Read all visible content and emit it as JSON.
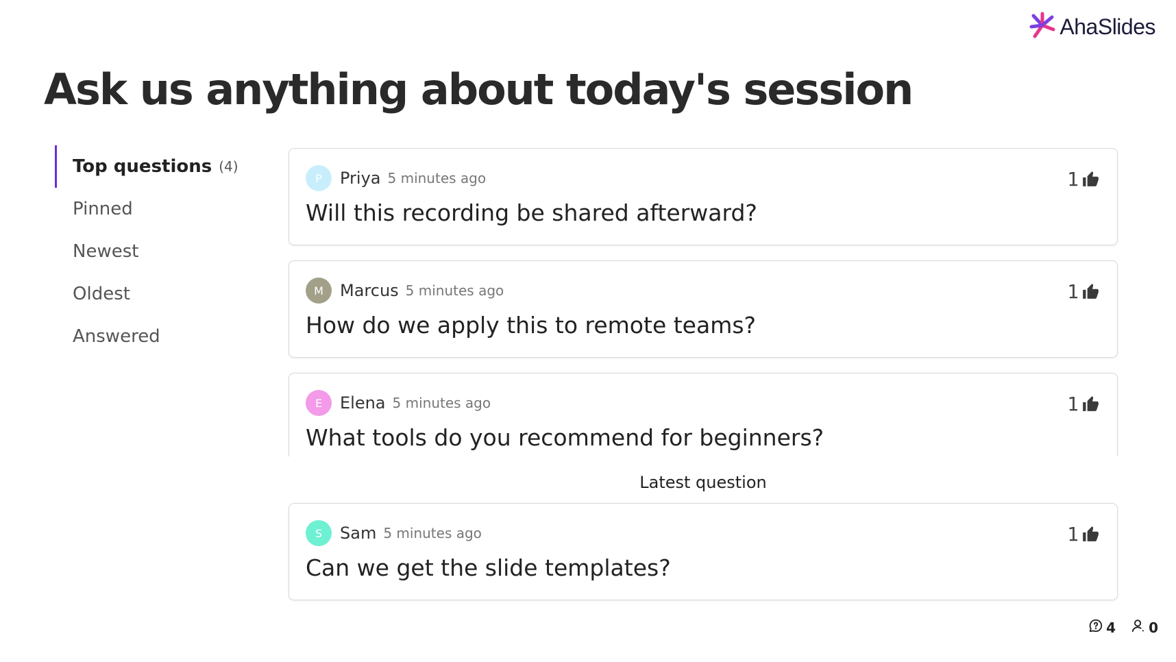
{
  "brand": {
    "name": "AhaSlides"
  },
  "title": "Ask us anything about today's session",
  "tabs": [
    {
      "label": "Top questions",
      "count": "(4)"
    },
    {
      "label": "Pinned"
    },
    {
      "label": "Newest"
    },
    {
      "label": "Oldest"
    },
    {
      "label": "Answered"
    }
  ],
  "questions": [
    {
      "initial": "P",
      "name": "Priya",
      "time": "5 minutes ago",
      "text": "Will this recording be shared afterward?",
      "votes": "1",
      "avatar_color": "#c8eefc"
    },
    {
      "initial": "M",
      "name": "Marcus",
      "time": "5 minutes ago",
      "text": "How do we apply this to remote teams?",
      "votes": "1",
      "avatar_color": "#a3a08a"
    },
    {
      "initial": "E",
      "name": "Elena",
      "time": "5 minutes ago",
      "text": "What tools do you recommend for beginners?",
      "votes": "1",
      "avatar_color": "#f39ae8"
    }
  ],
  "latest": {
    "label": "Latest question",
    "question": {
      "initial": "S",
      "name": "Sam",
      "time": "5 minutes ago",
      "text": "Can we get the slide templates?",
      "votes": "1",
      "avatar_color": "#6ef0d3"
    }
  },
  "footer": {
    "questions_count": "4",
    "participants_count": "0"
  },
  "colors": {
    "accent": "#6c2bd9",
    "logo_pink": "#e8358c",
    "logo_purple": "#7b3fe4"
  },
  "icons": {
    "vote": "thumbs-up-icon",
    "questions": "question-bubble-icon",
    "participants": "person-icon",
    "logo": "ahaslides-logo-icon"
  }
}
